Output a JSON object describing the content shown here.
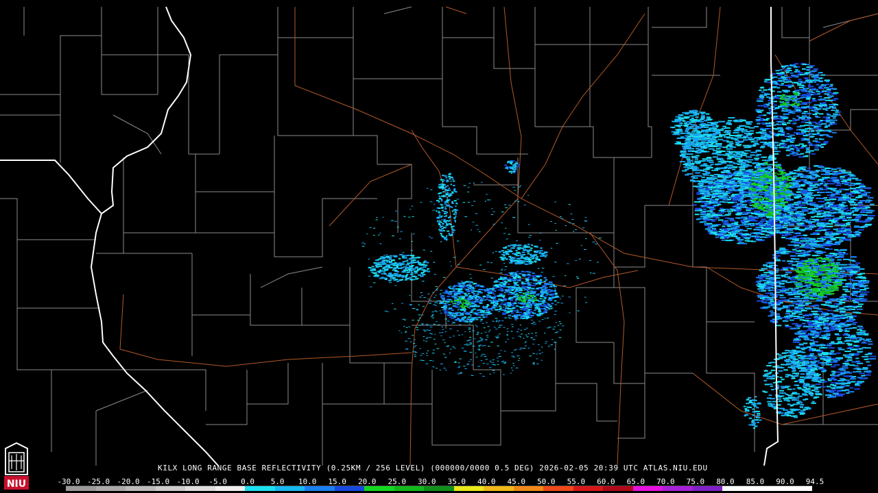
{
  "caption": "KILX LONG RANGE BASE REFLECTIVITY (0.25KM / 256 LEVEL) (000000/0000 0.5 DEG) 2026-02-05 20:39 UTC  ATLAS.NIU.EDU",
  "logo": {
    "text": "NIU",
    "color": "#c8102e"
  },
  "scale": {
    "labels": [
      "-30.0",
      "-25.0",
      "-20.0",
      "-15.0",
      "-10.0",
      "-5.0",
      "0.0",
      "5.0",
      "10.0",
      "15.0",
      "20.0",
      "25.0",
      "30.0",
      "35.0",
      "40.0",
      "45.0",
      "50.0",
      "55.0",
      "60.0",
      "65.0",
      "70.0",
      "75.0",
      "80.0",
      "85.0",
      "90.0",
      "94.5"
    ],
    "colors": [
      "#9a9a9a",
      "#aaaaaa",
      "#bbbbbb",
      "#cccccc",
      "#dddddd",
      "#eeeeee",
      "#1ce0f0",
      "#18b8f0",
      "#1a7ff0",
      "#1848e0",
      "#14d820",
      "#12b81a",
      "#10901a",
      "#e8e81a",
      "#f0b818",
      "#f08818",
      "#f04818",
      "#d81818",
      "#b00818",
      "#e810e0",
      "#a820d8",
      "#8020c8",
      "#ffffff",
      "#ffffff",
      "#ffffff"
    ]
  },
  "map_colors": {
    "background": "#000000",
    "state_border": "#ffffff",
    "county_border": "#8c8c8c",
    "highway": "#b35a2a"
  }
}
